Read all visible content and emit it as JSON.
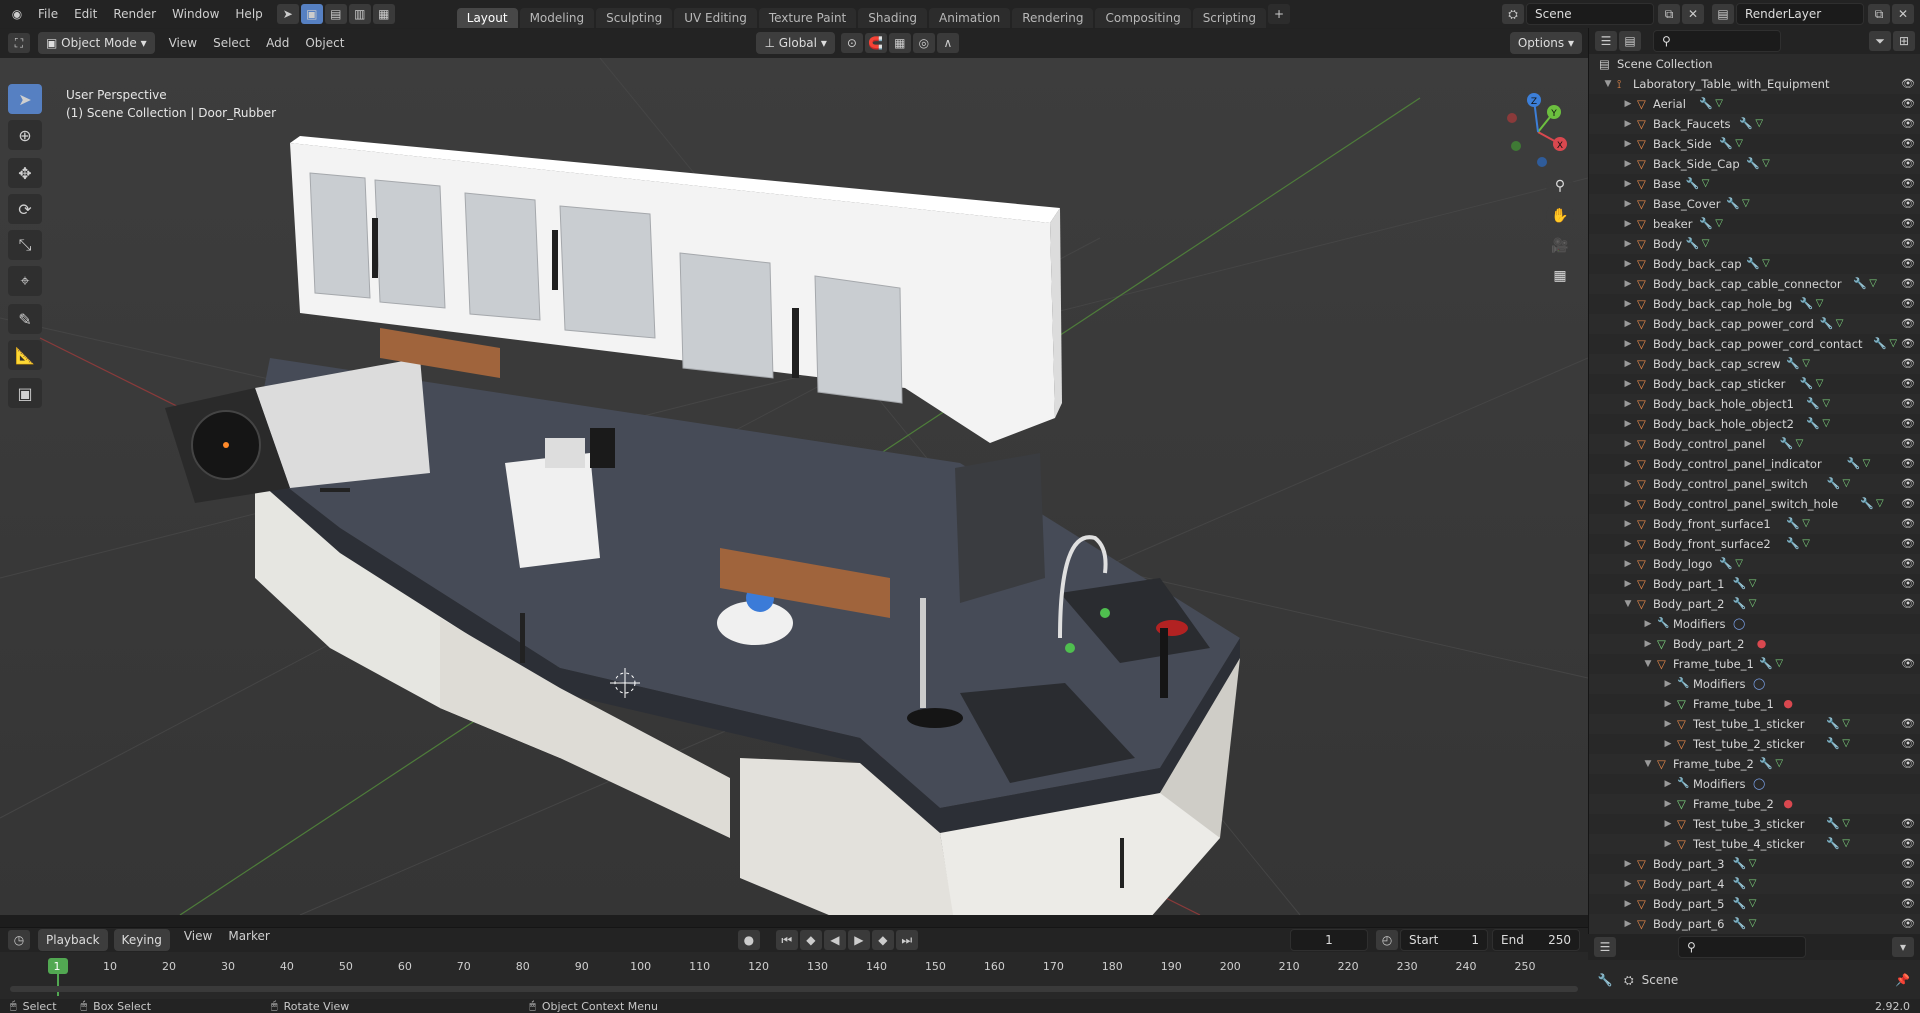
{
  "app": {
    "menus": [
      "File",
      "Edit",
      "Render",
      "Window",
      "Help"
    ],
    "workspaces": [
      "Layout",
      "Modeling",
      "Sculpting",
      "UV Editing",
      "Texture Paint",
      "Shading",
      "Animation",
      "Rendering",
      "Compositing",
      "Scripting"
    ],
    "active_workspace": "Layout",
    "scene": "Scene",
    "render_layer": "RenderLayer",
    "version": "2.92.0"
  },
  "viewport_header": {
    "mode": "Object Mode",
    "menus": [
      "View",
      "Select",
      "Add",
      "Object"
    ],
    "orientation": "Global",
    "options": "Options"
  },
  "viewport": {
    "perspective": "User Perspective",
    "context": "(1) Scene Collection | Door_Rubber"
  },
  "gizmo": {
    "x": "X",
    "y": "Y",
    "z": "Z"
  },
  "outliner": {
    "root": "Scene Collection",
    "rows": [
      {
        "label": "Laboratory_Table_with_Equipment",
        "depth": 0,
        "kind": "collection",
        "expanded": true
      },
      {
        "label": "Aerial",
        "depth": 1,
        "kind": "object"
      },
      {
        "label": "Back_Faucets",
        "depth": 1,
        "kind": "object"
      },
      {
        "label": "Back_Side",
        "depth": 1,
        "kind": "object"
      },
      {
        "label": "Back_Side_Cap",
        "depth": 1,
        "kind": "object"
      },
      {
        "label": "Base",
        "depth": 1,
        "kind": "object"
      },
      {
        "label": "Base_Cover",
        "depth": 1,
        "kind": "object"
      },
      {
        "label": "beaker",
        "depth": 1,
        "kind": "object"
      },
      {
        "label": "Body",
        "depth": 1,
        "kind": "object"
      },
      {
        "label": "Body_back_cap",
        "depth": 1,
        "kind": "object"
      },
      {
        "label": "Body_back_cap_cable_connector",
        "depth": 1,
        "kind": "object"
      },
      {
        "label": "Body_back_cap_hole_bg",
        "depth": 1,
        "kind": "object"
      },
      {
        "label": "Body_back_cap_power_cord",
        "depth": 1,
        "kind": "object"
      },
      {
        "label": "Body_back_cap_power_cord_contact",
        "depth": 1,
        "kind": "object"
      },
      {
        "label": "Body_back_cap_screw",
        "depth": 1,
        "kind": "object"
      },
      {
        "label": "Body_back_cap_sticker",
        "depth": 1,
        "kind": "object"
      },
      {
        "label": "Body_back_hole_object1",
        "depth": 1,
        "kind": "object"
      },
      {
        "label": "Body_back_hole_object2",
        "depth": 1,
        "kind": "object"
      },
      {
        "label": "Body_control_panel",
        "depth": 1,
        "kind": "object"
      },
      {
        "label": "Body_control_panel_indicator",
        "depth": 1,
        "kind": "object"
      },
      {
        "label": "Body_control_panel_switch",
        "depth": 1,
        "kind": "object"
      },
      {
        "label": "Body_control_panel_switch_hole",
        "depth": 1,
        "kind": "object"
      },
      {
        "label": "Body_front_surface1",
        "depth": 1,
        "kind": "object"
      },
      {
        "label": "Body_front_surface2",
        "depth": 1,
        "kind": "object"
      },
      {
        "label": "Body_logo",
        "depth": 1,
        "kind": "object"
      },
      {
        "label": "Body_part_1",
        "depth": 1,
        "kind": "object"
      },
      {
        "label": "Body_part_2",
        "depth": 1,
        "kind": "object",
        "expanded": true
      },
      {
        "label": "Modifiers",
        "depth": 2,
        "kind": "modifiers"
      },
      {
        "label": "Body_part_2",
        "depth": 2,
        "kind": "mesh"
      },
      {
        "label": "Frame_tube_1",
        "depth": 2,
        "kind": "object",
        "expanded": true
      },
      {
        "label": "Modifiers",
        "depth": 3,
        "kind": "modifiers"
      },
      {
        "label": "Frame_tube_1",
        "depth": 3,
        "kind": "mesh"
      },
      {
        "label": "Test_tube_1_sticker",
        "depth": 3,
        "kind": "object"
      },
      {
        "label": "Test_tube_2_sticker",
        "depth": 3,
        "kind": "object"
      },
      {
        "label": "Frame_tube_2",
        "depth": 2,
        "kind": "object",
        "expanded": true
      },
      {
        "label": "Modifiers",
        "depth": 3,
        "kind": "modifiers"
      },
      {
        "label": "Frame_tube_2",
        "depth": 3,
        "kind": "mesh"
      },
      {
        "label": "Test_tube_3_sticker",
        "depth": 3,
        "kind": "object"
      },
      {
        "label": "Test_tube_4_sticker",
        "depth": 3,
        "kind": "object"
      },
      {
        "label": "Body_part_3",
        "depth": 1,
        "kind": "object"
      },
      {
        "label": "Body_part_4",
        "depth": 1,
        "kind": "object"
      },
      {
        "label": "Body_part_5",
        "depth": 1,
        "kind": "object"
      },
      {
        "label": "Body_part_6",
        "depth": 1,
        "kind": "object"
      }
    ]
  },
  "timeline": {
    "menus": [
      "Playback",
      "Keying",
      "View",
      "Marker"
    ],
    "current_frame": "1",
    "start_label": "Start",
    "start": "1",
    "end_label": "End",
    "end": "250",
    "ticks": [
      "1",
      "10",
      "20",
      "30",
      "40",
      "50",
      "60",
      "70",
      "80",
      "90",
      "100",
      "110",
      "120",
      "130",
      "140",
      "150",
      "160",
      "170",
      "180",
      "190",
      "200",
      "210",
      "220",
      "230",
      "240",
      "250"
    ]
  },
  "properties": {
    "scene": "Scene"
  },
  "statusbar": {
    "select": "Select",
    "box_select": "Box Select",
    "rotate": "Rotate View",
    "context_menu": "Object Context Menu"
  },
  "colors": {
    "accent": "#5680c2",
    "object_icon": "#e8894a",
    "mesh_icon": "#7fd67f",
    "modifier_icon": "#7aa0e6",
    "frame_marker": "#52a852"
  }
}
